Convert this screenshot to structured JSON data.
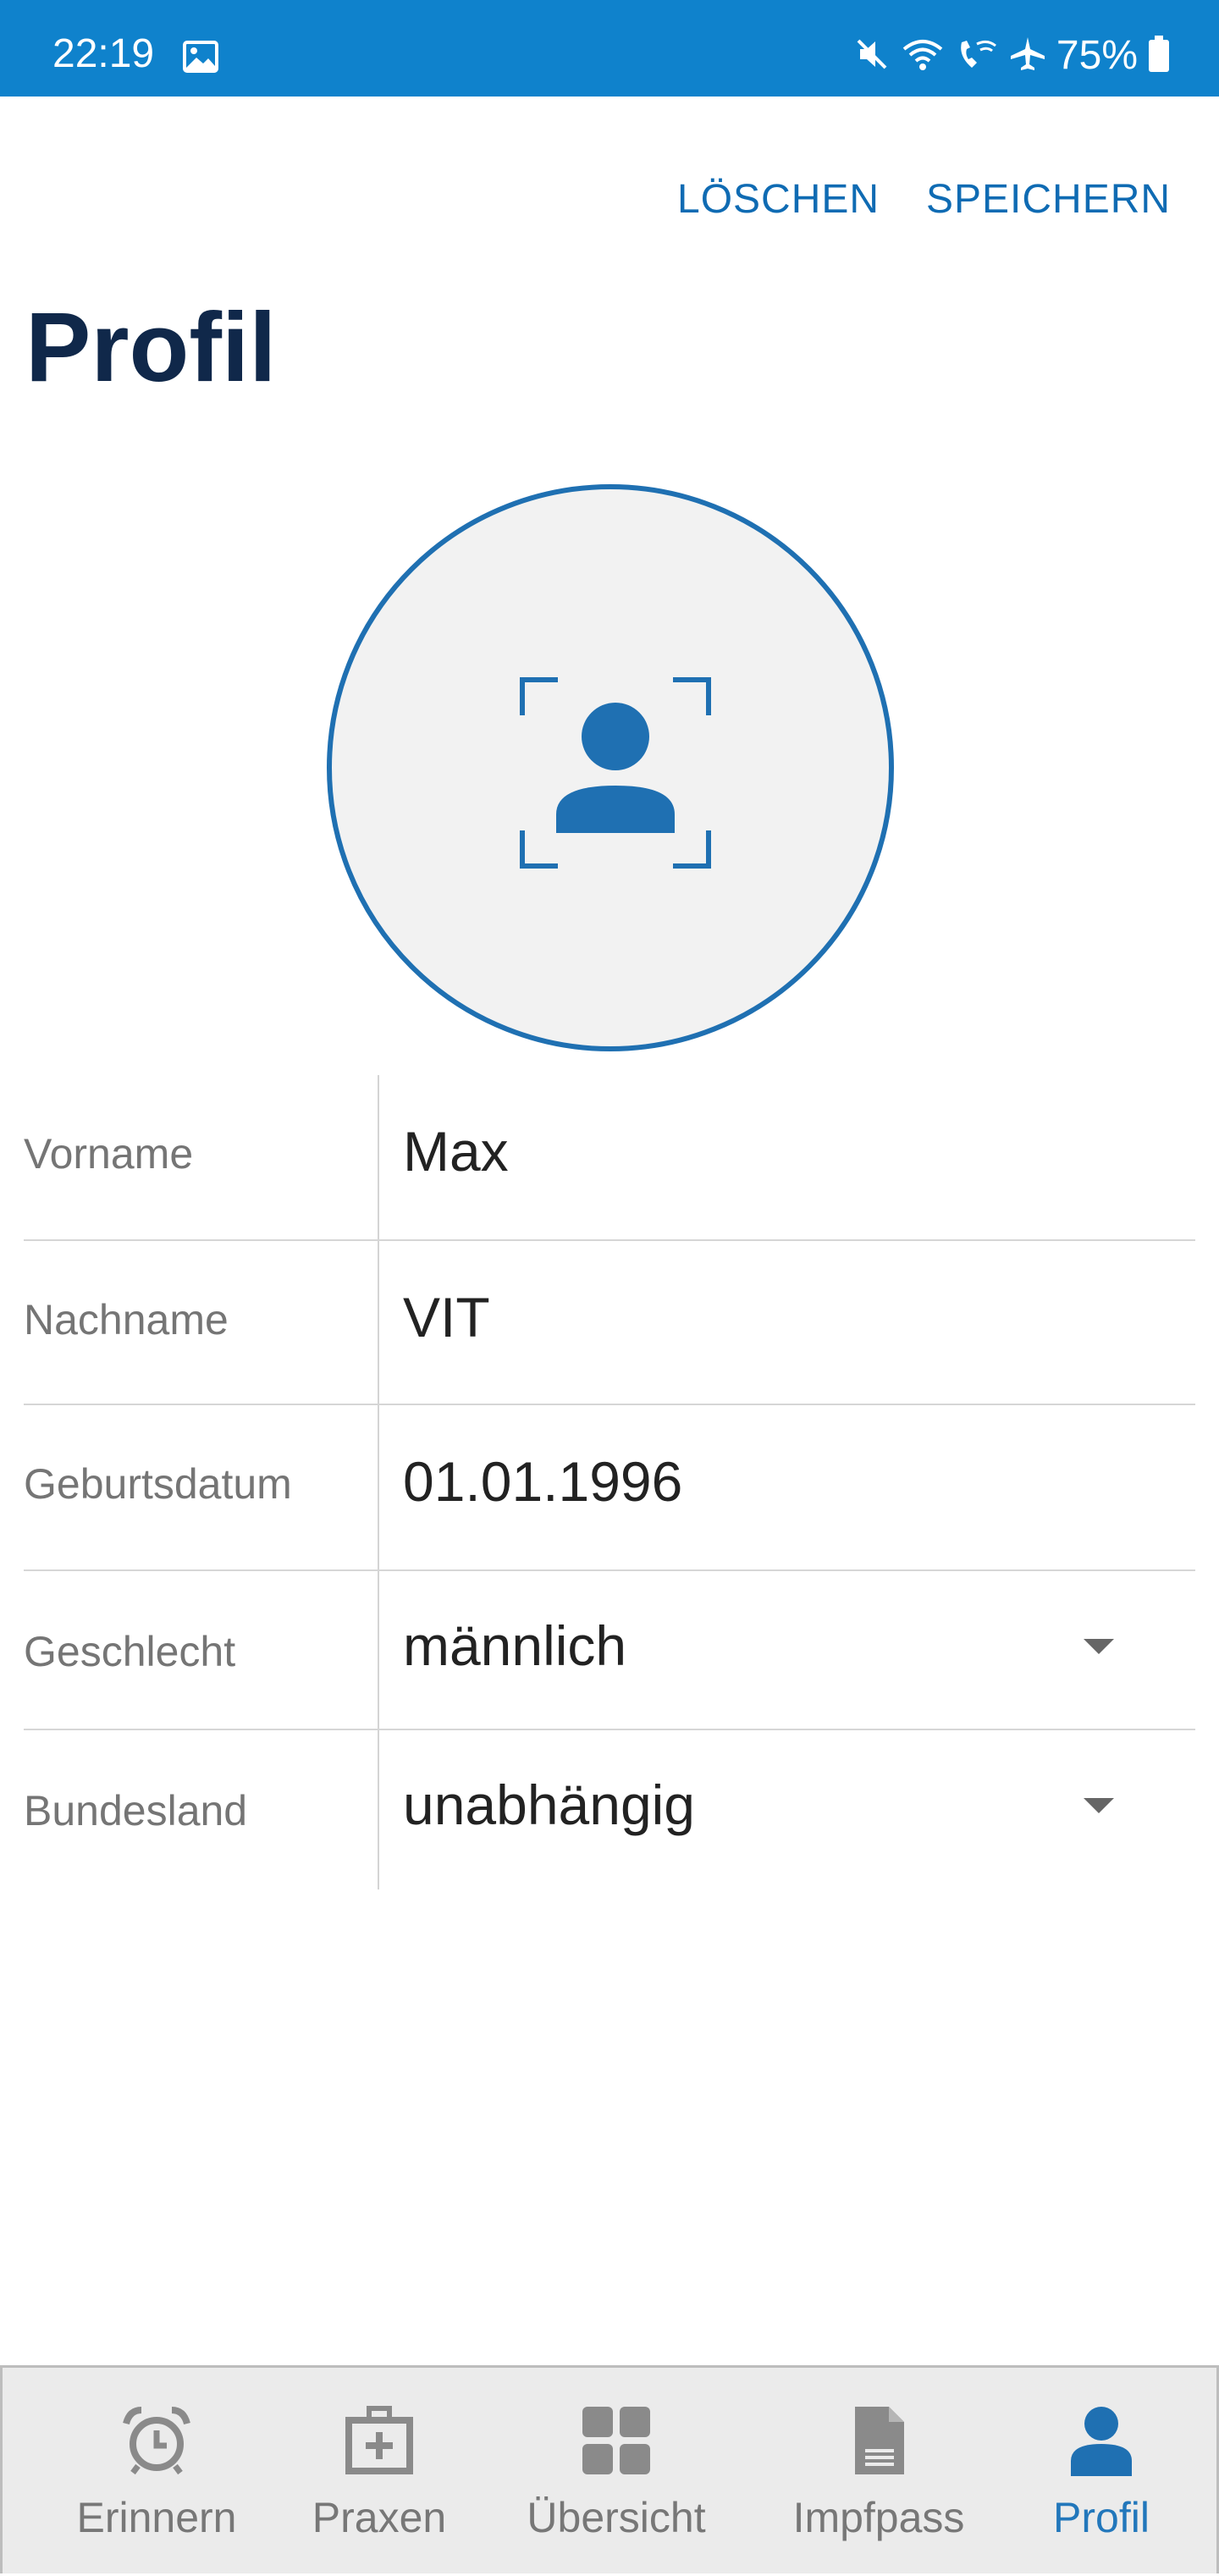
{
  "status_bar": {
    "time": "22:19",
    "battery": "75%",
    "icons": [
      "gallery-icon",
      "mute-icon",
      "wifi-icon",
      "wifi-call-icon",
      "airplane-icon",
      "battery-icon"
    ]
  },
  "actions": {
    "delete_label": "LÖSCHEN",
    "save_label": "SPEICHERN"
  },
  "page": {
    "title": "Profil"
  },
  "avatar": {
    "icon": "profile-scan-icon"
  },
  "form": {
    "rows": [
      {
        "label": "Vorname",
        "value": "Max"
      },
      {
        "label": "Nachname",
        "value": "VIT"
      },
      {
        "label": "Geburtsdatum",
        "value": "01.01.1996"
      },
      {
        "label": "Geschlecht",
        "value": "männlich"
      },
      {
        "label": "Bundesland",
        "value": "unabhängig"
      }
    ]
  },
  "bottom_nav": {
    "items": [
      {
        "label": "Erinnern",
        "icon": "alarm-clock-icon",
        "active": false
      },
      {
        "label": "Praxen",
        "icon": "medical-bag-icon",
        "active": false
      },
      {
        "label": "Übersicht",
        "icon": "dashboard-grid-icon",
        "active": false
      },
      {
        "label": "Impfpass",
        "icon": "document-icon",
        "active": false
      },
      {
        "label": "Profil",
        "icon": "person-icon",
        "active": true
      }
    ]
  },
  "colors": {
    "status_bar": "#0f82cc",
    "accent": "#1f70b2",
    "title": "#10284a",
    "nav_inactive": "#8a8a8a",
    "nav_active": "#1f70b2"
  }
}
